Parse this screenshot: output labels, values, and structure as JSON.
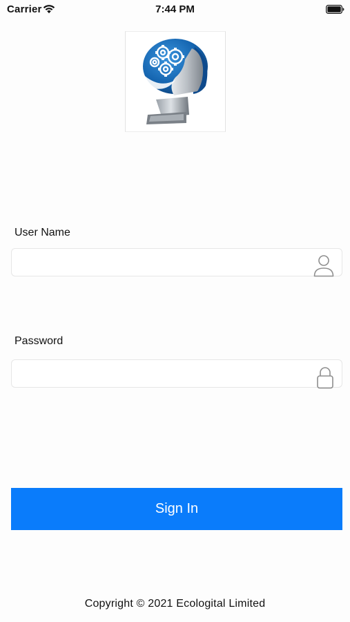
{
  "status_bar": {
    "carrier": "Carrier",
    "time": "7:44 PM",
    "wifi_icon": "wifi-icon",
    "battery_icon": "battery-icon"
  },
  "logo": {
    "icon": "head-gears-logo",
    "colors": {
      "helmet_blue": "#1565b0",
      "helmet_dark": "#0d3d73",
      "metal_gray": "#b9bec4"
    }
  },
  "form": {
    "username": {
      "label": "User Name",
      "value": "",
      "placeholder": "",
      "icon": "user-icon"
    },
    "password": {
      "label": "Password",
      "value": "",
      "placeholder": "",
      "icon": "lock-icon"
    },
    "sign_in_label": "Sign In"
  },
  "footer": {
    "copyright": "Copyright © 2021 Ecologital Limited"
  },
  "colors": {
    "accent": "#0a7cfb",
    "background": "#fdfdfd",
    "field_border": "#e6e6e6",
    "icon_gray": "#8e8e8e"
  }
}
